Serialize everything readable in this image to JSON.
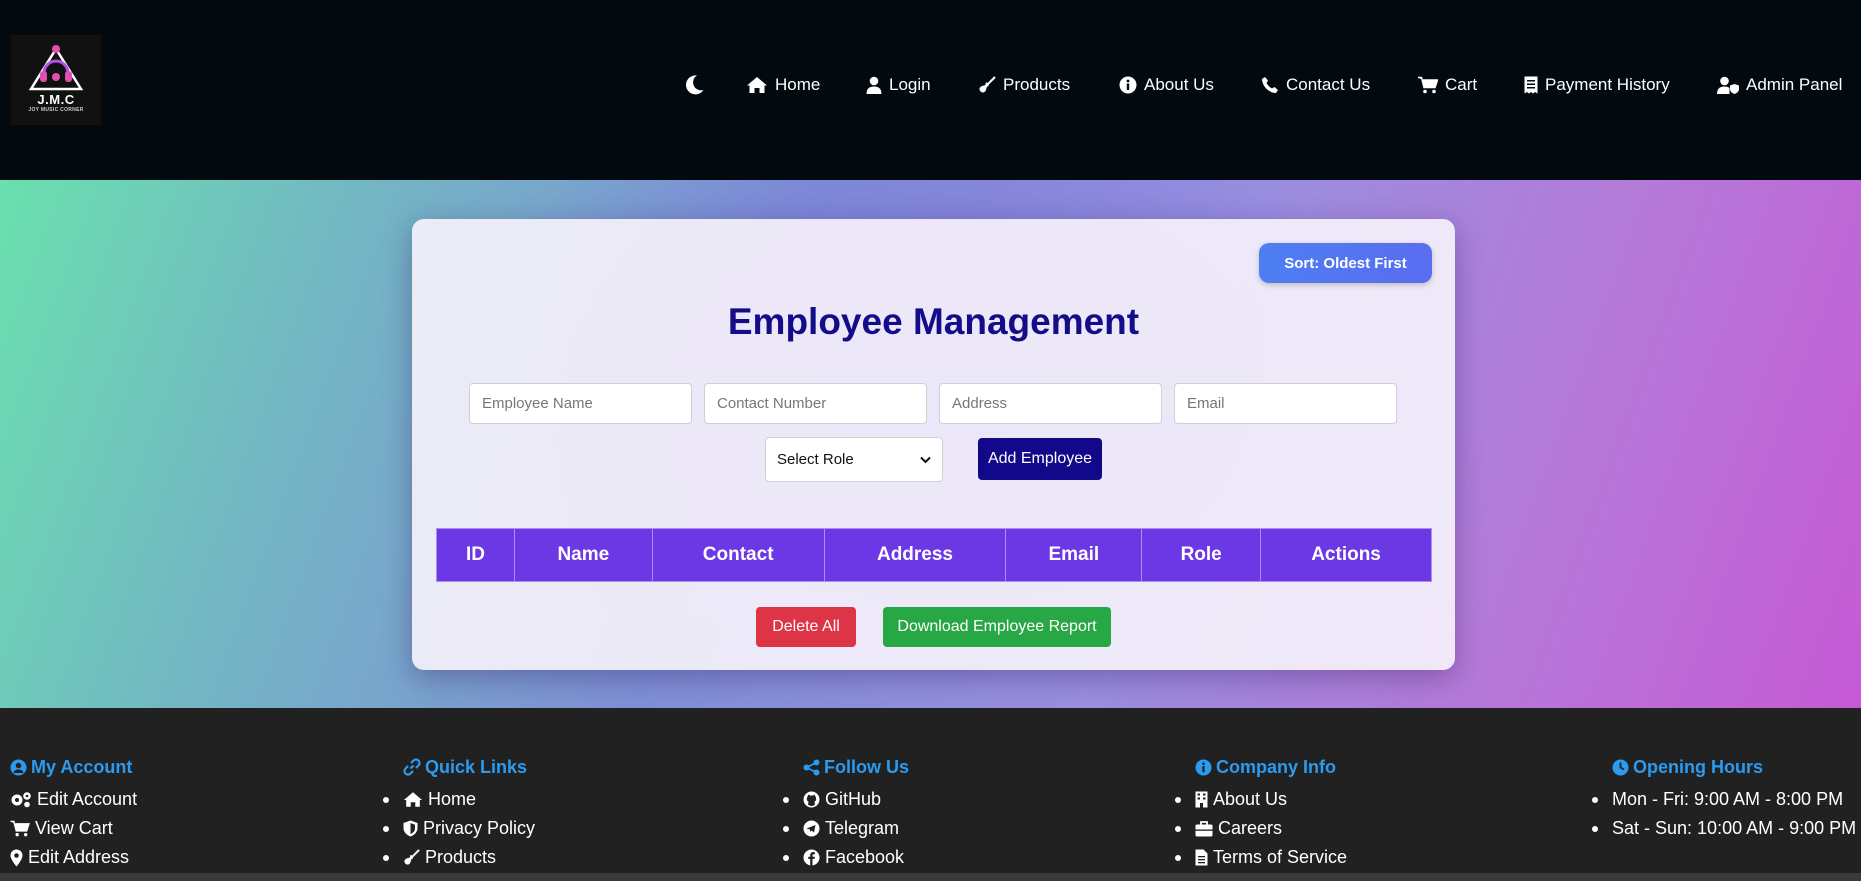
{
  "brand": {
    "logo_main": "J.M.C",
    "logo_sub": "JOY MUSIC CORNER",
    "accent": "#e24fb0"
  },
  "nav": [
    {
      "label": "Home",
      "icon": "home-icon"
    },
    {
      "label": "Login",
      "icon": "user-icon"
    },
    {
      "label": "Products",
      "icon": "guitar-icon"
    },
    {
      "label": "About Us",
      "icon": "info-circle-icon"
    },
    {
      "label": "Contact Us",
      "icon": "phone-icon"
    },
    {
      "label": "Cart",
      "icon": "cart-icon"
    },
    {
      "label": "Payment History",
      "icon": "receipt-icon"
    },
    {
      "label": "Admin Panel",
      "icon": "user-shield-icon"
    }
  ],
  "theme_toggle_icon": "moon-icon",
  "main": {
    "sort_label": "Sort: Oldest First",
    "title": "Employee Management",
    "form": {
      "name_placeholder": "Employee Name",
      "contact_placeholder": "Contact Number",
      "address_placeholder": "Address",
      "email_placeholder": "Email",
      "role_selected": "Select Role",
      "add_label": "Add Employee"
    },
    "table": {
      "columns": [
        "ID",
        "Name",
        "Contact",
        "Address",
        "Email",
        "Role",
        "Actions"
      ],
      "rows": []
    },
    "delete_all_label": "Delete All",
    "download_label": "Download Employee Report"
  },
  "footer": {
    "my_account": {
      "title": "My Account",
      "items": [
        "Edit Account",
        "View Cart",
        "Edit Address"
      ]
    },
    "quick_links": {
      "title": "Quick Links",
      "items": [
        "Home",
        "Privacy Policy",
        "Products"
      ]
    },
    "follow_us": {
      "title": "Follow Us",
      "items": [
        "GitHub",
        "Telegram",
        "Facebook"
      ]
    },
    "company_info": {
      "title": "Company Info",
      "items": [
        "About Us",
        "Careers",
        "Terms of Service"
      ]
    },
    "opening_hours": {
      "title": "Opening Hours",
      "items": [
        "Mon - Fri: 9:00 AM - 8:00 PM",
        "Sat - Sun: 10:00 AM - 9:00 PM"
      ]
    }
  },
  "colors": {
    "header_bg": "#020a10",
    "title": "#130d8a",
    "table_header": "#6c38e6",
    "footer_heading": "#2b9bf0",
    "danger": "#dd3545",
    "success": "#28a745",
    "add_button": "#12088a"
  }
}
